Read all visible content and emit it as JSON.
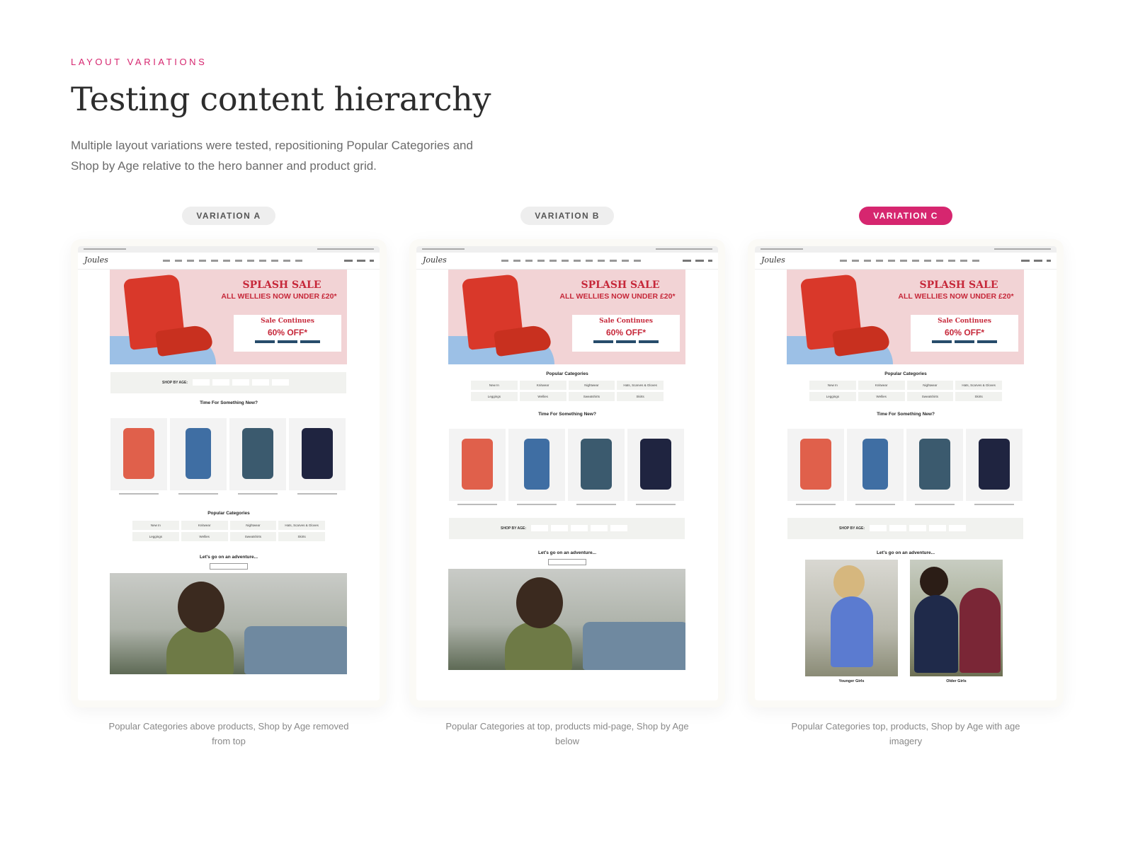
{
  "header": {
    "eyebrow": "LAYOUT VARIATIONS",
    "title": "Testing content hierarchy",
    "intro": "Multiple layout variations were tested, repositioning Popular Categories and Shop by Age relative to the hero banner and product grid."
  },
  "variations": [
    {
      "label": "VARIATION A",
      "active": false,
      "caption": "Popular Categories above products, Shop by Age removed from top"
    },
    {
      "label": "VARIATION B",
      "active": false,
      "caption": "Popular Categories at top, products mid-page, Shop by Age below"
    },
    {
      "label": "VARIATION C",
      "active": true,
      "caption": "Popular Categories top, products, Shop by Age with age imagery"
    }
  ],
  "mockup": {
    "logo": "Joules",
    "hero": {
      "title": "SPLASH SALE",
      "subtitle": "ALL WELLIES NOW UNDER £20*",
      "box_title": "Sale Continues",
      "box_offer": "60% OFF*"
    },
    "shop_by_age_label": "SHOP BY AGE:",
    "time_for_something_new": "Time For Something New?",
    "popular_categories_title": "Popular Categories",
    "categories": [
      "New In",
      "Knitwear",
      "Nightwear",
      "Hats, Scarves & Gloves",
      "Leggings",
      "Wellies",
      "Sweatshirts",
      "Skirts"
    ],
    "adventure_title": "Let's go on an adventure...",
    "younger_girls": "Younger Girls",
    "older_girls": "Older Girls"
  },
  "colors": {
    "accent": "#d6266f",
    "hero_pink": "#f2d3d5",
    "sale_red": "#c6283a"
  }
}
